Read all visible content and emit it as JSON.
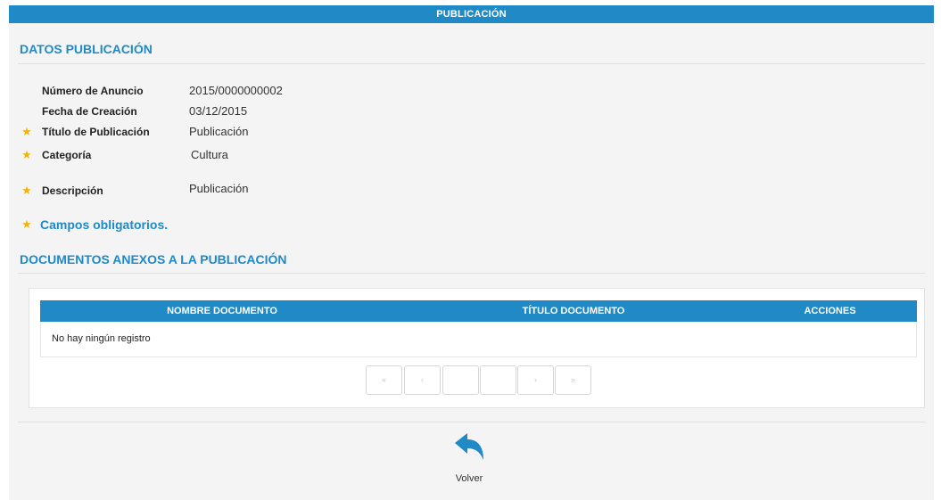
{
  "header": {
    "title": "PUBLICACIÓN"
  },
  "datos": {
    "title": "DATOS PUBLICACIÓN",
    "fields": [
      {
        "label": "Número de Anuncio",
        "value": "2015/0000000002",
        "required": false
      },
      {
        "label": "Fecha de Creación",
        "value": "03/12/2015",
        "required": false
      },
      {
        "label": "Título de Publicación",
        "value": "Publicación",
        "required": true
      },
      {
        "label": "Categoría",
        "value": "Cultura",
        "required": true
      },
      {
        "label": "Descripción",
        "value": "Publicación",
        "required": true
      }
    ],
    "required_note": "Campos obligatorios."
  },
  "documentos": {
    "title": "DOCUMENTOS ANEXOS A LA PUBLICACIÓN",
    "columns": [
      "NOMBRE DOCUMENTO",
      "TÍTULO DOCUMENTO",
      "ACCIONES"
    ],
    "empty_text": "No hay ningún registro",
    "pager": {
      "first": "«",
      "prev": "‹",
      "page_a": "",
      "page_b": "",
      "next": "›",
      "last": "»"
    }
  },
  "actions": {
    "back_label": "Volver"
  },
  "colors": {
    "accent": "#1f8ac6",
    "star": "#f5b400",
    "panel_bg": "#f4f4f4"
  },
  "icons": {
    "required": "star-icon",
    "back": "reply-arrow-icon"
  }
}
